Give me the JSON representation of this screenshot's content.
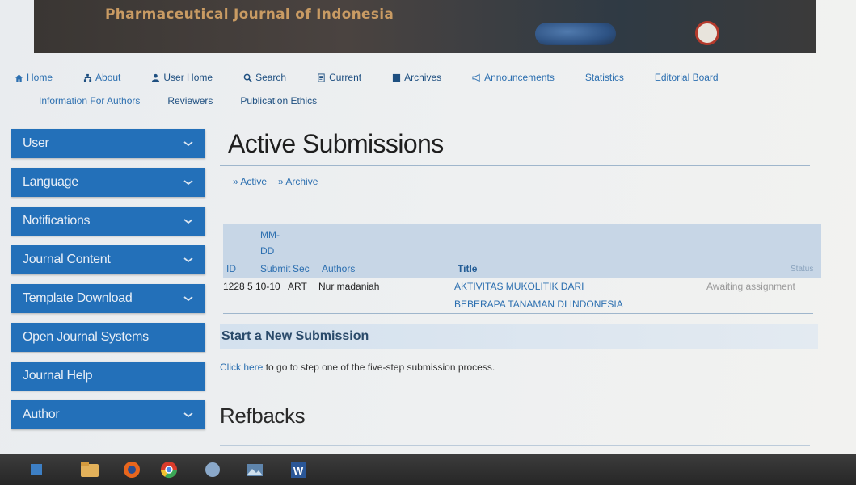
{
  "header": {
    "journal_title": "Pharmaceutical Journal of Indonesia",
    "logo_caption": "",
    "colors": {
      "banner": "#3a3633",
      "title": "#c99b63"
    }
  },
  "topnav": {
    "row1": [
      {
        "label": "Home",
        "icon": "home-icon"
      },
      {
        "label": "About",
        "icon": "sitemap-icon"
      },
      {
        "label": "User Home",
        "icon": "user-icon"
      },
      {
        "label": "Search",
        "icon": "search-icon"
      },
      {
        "label": "Current",
        "icon": "document-icon"
      },
      {
        "label": "Archives",
        "icon": "book-icon"
      },
      {
        "label": "Announcements",
        "icon": "megaphone-icon"
      },
      {
        "label": "Statistics",
        "icon": ""
      },
      {
        "label": "Editorial Board",
        "icon": ""
      }
    ],
    "row2": [
      {
        "label": "Information For Authors"
      },
      {
        "label": "Reviewers"
      },
      {
        "label": "Publication Ethics"
      }
    ]
  },
  "sidebar": {
    "items": [
      {
        "label": "User",
        "expandable": true
      },
      {
        "label": "Language",
        "expandable": true
      },
      {
        "label": "Notifications",
        "expandable": true
      },
      {
        "label": "Journal Content",
        "expandable": true
      },
      {
        "label": "Template Download",
        "expandable": true
      },
      {
        "label": "Open Journal Systems",
        "expandable": false
      },
      {
        "label": "Journal Help",
        "expandable": false
      },
      {
        "label": "Author",
        "expandable": true
      }
    ],
    "accent": "#2370b9"
  },
  "main": {
    "page_title": "Active Submissions",
    "subnav": [
      "» Active",
      "» Archive"
    ],
    "table": {
      "headers": {
        "id": "ID",
        "date_line1": "MM-",
        "date_line2": "DD",
        "submit": "Submit",
        "sec": "Sec",
        "authors": "Authors",
        "title": "Title",
        "status": "Status"
      },
      "rows": [
        {
          "id": "1228",
          "date": "5",
          "submit": "10-10",
          "sec": "ART",
          "authors": "Nur madaniah",
          "title_line1": "AKTIVITAS MUKOLITIK DARI",
          "title_line2": "BEBERAPA TANAMAN DI INDONESIA",
          "status": "Awaiting assignment"
        }
      ]
    },
    "new_submission": {
      "heading": "Start a New Submission",
      "link_text": "Click here",
      "rest_text": " to go to step one of the five-step submission process."
    },
    "refbacks_heading": "Refbacks"
  },
  "taskbar": {
    "apps": [
      "start-button",
      "file-explorer-icon",
      "firefox-icon",
      "chrome-icon",
      "media-icon",
      "photos-icon",
      "word-icon"
    ]
  }
}
